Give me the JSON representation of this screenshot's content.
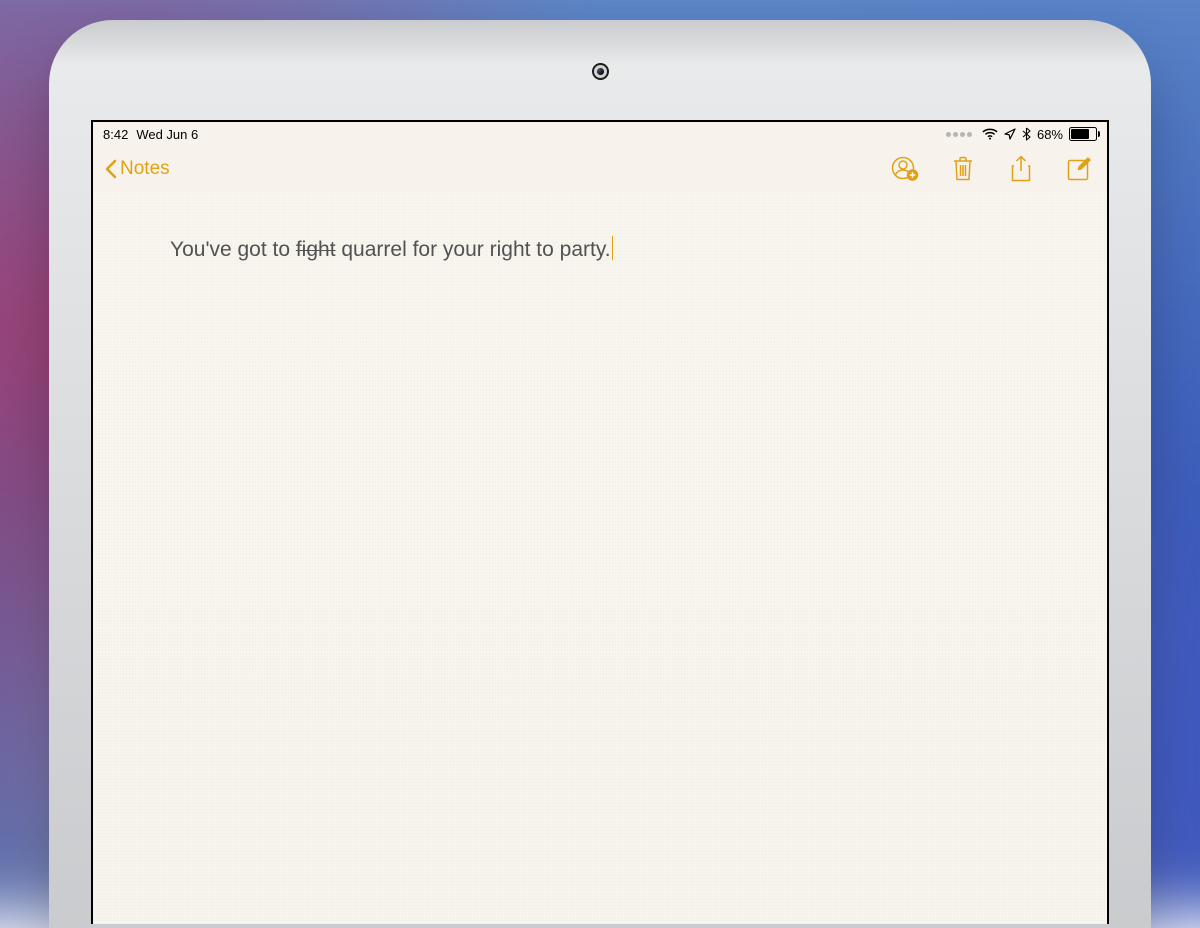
{
  "colors": {
    "accent": "#e1a115"
  },
  "status": {
    "time": "8:42",
    "date": "Wed Jun 6",
    "battery_percent": "68%"
  },
  "navbar": {
    "back_label": "Notes",
    "icons": {
      "add_person": "add-person-icon",
      "trash": "trash-icon",
      "share": "share-icon",
      "compose": "compose-icon"
    }
  },
  "note": {
    "before": "You've got to ",
    "struck": "fight",
    "after": " quarrel for your right to party."
  }
}
